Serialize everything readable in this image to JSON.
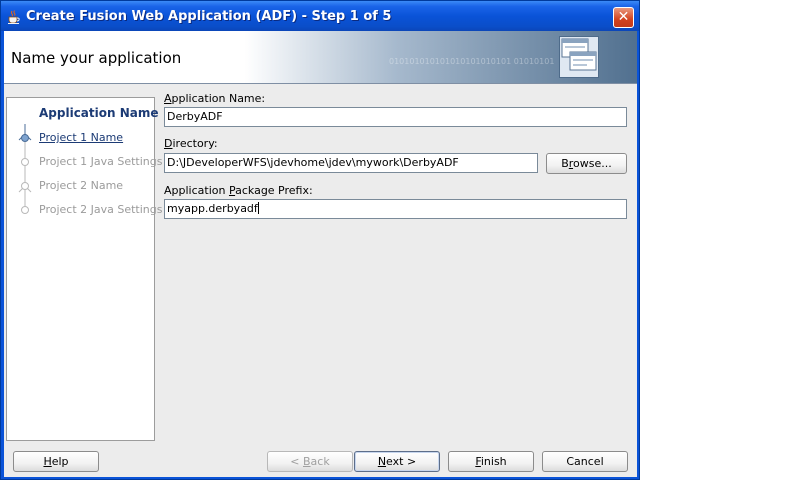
{
  "window": {
    "title": "Create Fusion Web Application (ADF) - Step 1 of 5",
    "close_glyph": "✕"
  },
  "header": {
    "title": "Name your application",
    "binary_text": "010101010101010101010101 01010101"
  },
  "steps": [
    {
      "label": "Application Name",
      "state": "current"
    },
    {
      "label": "Project 1 Name",
      "state": "link"
    },
    {
      "label": "Project 1 Java Settings",
      "state": "disabled"
    },
    {
      "label": "Project 2 Name",
      "state": "disabled"
    },
    {
      "label": "Project 2 Java Settings",
      "state": "disabled"
    }
  ],
  "form": {
    "app_name": {
      "label_m": "A",
      "label_rest": "pplication Name:",
      "value": "DerbyADF"
    },
    "directory": {
      "label_m": "D",
      "label_rest": "irectory:",
      "value": "D:\\JDeveloperWFS\\jdevhome\\jdev\\mywork\\DerbyADF"
    },
    "browse": {
      "pre": "B",
      "m": "r",
      "post": "owse..."
    },
    "package_prefix": {
      "label_pre": "Application ",
      "label_m": "P",
      "label_rest": "ackage Prefix:",
      "value": "myapp.derbyadf"
    }
  },
  "buttons": {
    "help": {
      "m": "H",
      "rest": "elp"
    },
    "back": {
      "pre": "< ",
      "m": "B",
      "rest": "ack"
    },
    "next": {
      "m": "N",
      "rest": "ext >"
    },
    "finish": {
      "m": "F",
      "rest": "inish"
    },
    "cancel": "Cancel"
  },
  "colors": {
    "titlebar": "#0a53d8",
    "current_step": "#1c3b75",
    "disabled_step": "#9b9b9b"
  }
}
